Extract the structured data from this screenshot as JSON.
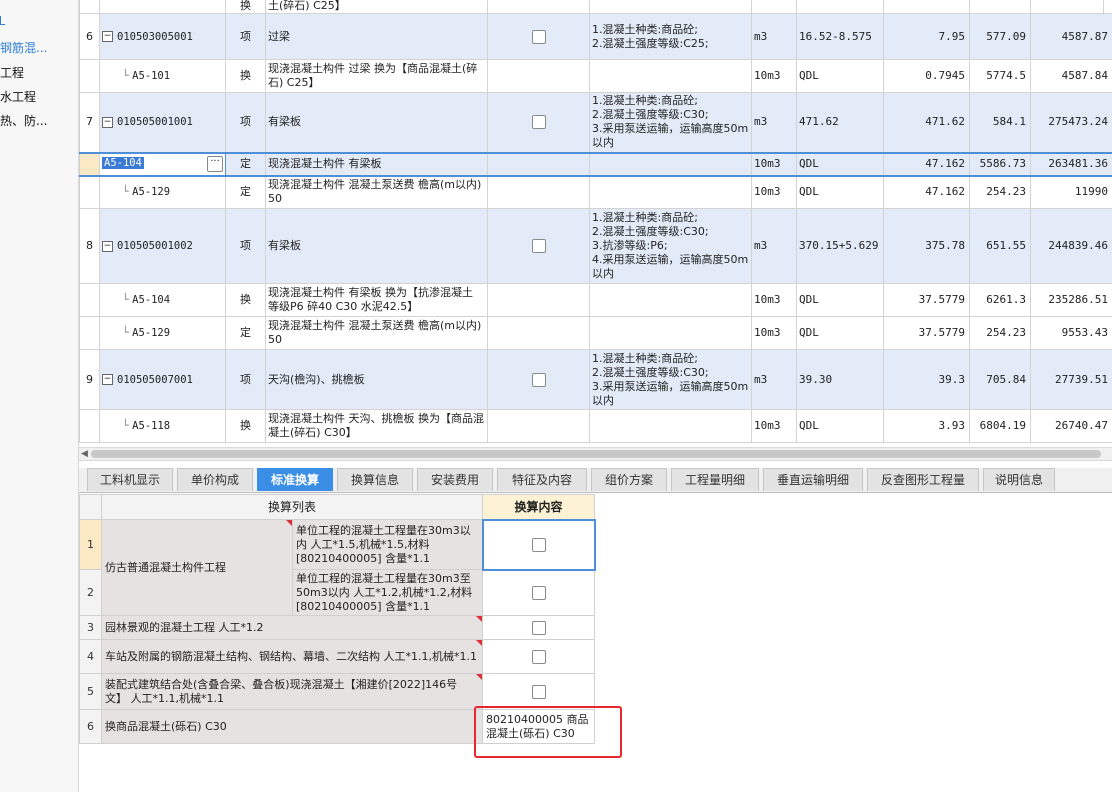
{
  "sidebar": {
    "items": [
      {
        "label": "钢筋混..."
      },
      {
        "label": "工程"
      },
      {
        "label": "水工程"
      },
      {
        "label": "热、防..."
      }
    ]
  },
  "top_partial": {
    "unit_text": "土(碎石) C25】",
    "type_text": "换"
  },
  "rows": [
    {
      "num": "6",
      "kind": "item",
      "code": "010503005001",
      "type": "项",
      "name": "过梁",
      "feature": "1.混凝土种类:商品砼;\n2.混凝土强度等级:C25;",
      "unit": "m3",
      "qty_expr": "16.52-8.575",
      "qty": "7.95",
      "price": "577.09",
      "total": "4587.87"
    },
    {
      "num": "",
      "kind": "sub",
      "code": "A5-101",
      "type": "换",
      "name": "现浇混凝土构件 过梁  换为【商品混凝土(碎石) C25】",
      "feature": "",
      "unit": "10m3",
      "qty_expr": "QDL",
      "qty": "0.7945",
      "price": "5774.5",
      "total": "4587.84"
    },
    {
      "num": "7",
      "kind": "item",
      "code": "010505001001",
      "type": "项",
      "name": "有梁板",
      "feature": "1.混凝土种类:商品砼;\n2.混凝土强度等级:C30;\n3.采用泵送运输，运输高度50m以内",
      "unit": "m3",
      "qty_expr": "471.62",
      "qty": "471.62",
      "price": "584.1",
      "total": "275473.24"
    },
    {
      "num": "",
      "kind": "selected",
      "code": "A5-104",
      "type": "定",
      "name": "现浇混凝土构件 有梁板",
      "feature": "",
      "unit": "10m3",
      "qty_expr": "QDL",
      "qty": "47.162",
      "price": "5586.73",
      "total": "263481.36"
    },
    {
      "num": "",
      "kind": "sub",
      "code": "A5-129",
      "type": "定",
      "name": "现浇混凝土构件 混凝土泵送费 檐高(m以内) 50",
      "feature": "",
      "unit": "10m3",
      "qty_expr": "QDL",
      "qty": "47.162",
      "price": "254.23",
      "total": "11990"
    },
    {
      "num": "8",
      "kind": "item",
      "code": "010505001002",
      "type": "项",
      "name": "有梁板",
      "feature": "1.混凝土种类:商品砼;\n2.混凝土强度等级:C30;\n3.抗渗等级:P6;\n4.采用泵送运输，运输高度50m以内",
      "unit": "m3",
      "qty_expr": "370.15+5.629",
      "qty": "375.78",
      "price": "651.55",
      "total": "244839.46"
    },
    {
      "num": "",
      "kind": "sub",
      "code": "A5-104",
      "type": "换",
      "name": "现浇混凝土构件 有梁板  换为【抗渗混凝土 等级P6 碎40 C30 水泥42.5】",
      "feature": "",
      "unit": "10m3",
      "qty_expr": "QDL",
      "qty": "37.5779",
      "price": "6261.3",
      "total": "235286.51"
    },
    {
      "num": "",
      "kind": "sub",
      "code": "A5-129",
      "type": "定",
      "name": "现浇混凝土构件 混凝土泵送费 檐高(m以内) 50",
      "feature": "",
      "unit": "10m3",
      "qty_expr": "QDL",
      "qty": "37.5779",
      "price": "254.23",
      "total": "9553.43"
    },
    {
      "num": "9",
      "kind": "item",
      "code": "010505007001",
      "type": "项",
      "name": "天沟(檐沟)、挑檐板",
      "feature": "1.混凝土种类:商品砼;\n2.混凝土强度等级:C30;\n3.采用泵送运输，运输高度50m以内",
      "unit": "m3",
      "qty_expr": "39.30",
      "qty": "39.3",
      "price": "705.84",
      "total": "27739.51"
    },
    {
      "num": "",
      "kind": "sub",
      "code": "A5-118",
      "type": "换",
      "name": "现浇混凝土构件 天沟、挑檐板  换为【商品混凝土(碎石) C30】",
      "feature": "",
      "unit": "10m3",
      "qty_expr": "QDL",
      "qty": "3.93",
      "price": "6804.19",
      "total": "26740.47"
    }
  ],
  "tabs": [
    {
      "label": "工料机显示"
    },
    {
      "label": "单价构成"
    },
    {
      "label": "标准换算"
    },
    {
      "label": "换算信息"
    },
    {
      "label": "安装费用"
    },
    {
      "label": "特征及内容"
    },
    {
      "label": "组价方案"
    },
    {
      "label": "工程量明细"
    },
    {
      "label": "垂直运输明细"
    },
    {
      "label": "反查图形工程量"
    },
    {
      "label": "说明信息"
    }
  ],
  "active_tab": "标准换算",
  "lower": {
    "col_list": "换算列表",
    "col_content": "换算内容",
    "group1_label": "仿古普通混凝土构件工程",
    "r1_text": "单位工程的混凝土工程量在30m3以内 人工*1.5,机械*1.5,材料[80210400005] 含量*1.1",
    "r2_text": "单位工程的混凝土工程量在30m3至50m3以内 人工*1.2,机械*1.2,材料[80210400005] 含量*1.1",
    "r3_text": "园林景观的混凝土工程 人工*1.2",
    "r4_text": "车站及附属的钢筋混凝土结构、钢结构、幕墙、二次结构 人工*1.1,机械*1.1",
    "r5_text": "装配式建筑结合处(含叠合梁、叠合板)现浇混凝土【湘建价[2022]146号文】 人工*1.1,机械*1.1",
    "r6_text": "换商品混凝土(砾石) C30",
    "r6_content": "80210400005  商品混凝土(砾石) C30",
    "row_nums": [
      "1",
      "2",
      "3",
      "4",
      "5",
      "6"
    ]
  },
  "colors": {
    "accent": "#3a8ee6",
    "row_blue": "#e2ebf7",
    "highlight": "#e5272e"
  }
}
